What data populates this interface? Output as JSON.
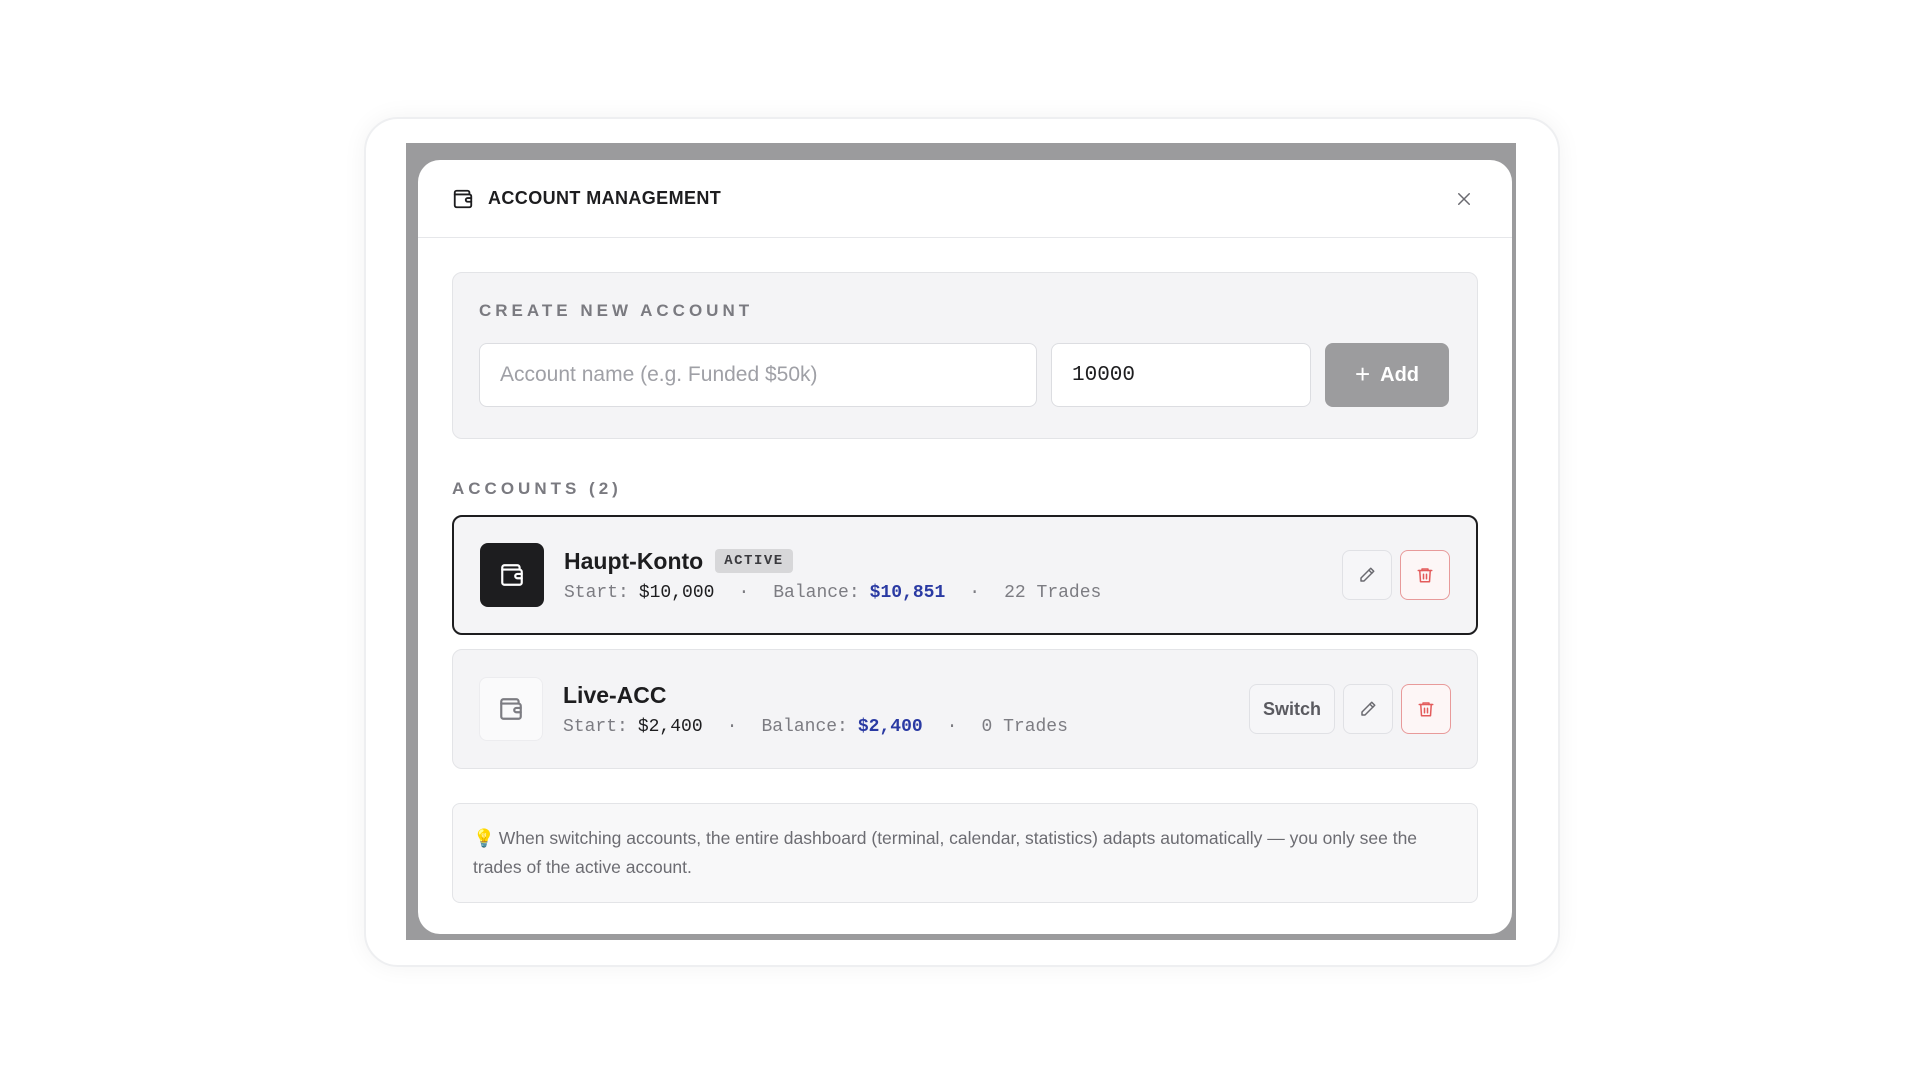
{
  "modal": {
    "title": "ACCOUNT MANAGEMENT",
    "header_icon": "wallet-icon",
    "close_icon": "close-icon"
  },
  "create": {
    "section_label": "CREATE NEW ACCOUNT",
    "name_placeholder": "Account name (e.g. Funded $50k)",
    "name_value": "",
    "amount_value": "10000",
    "add_label": "Add",
    "add_icon": "plus-icon"
  },
  "accounts": {
    "section_label": "ACCOUNTS (2)",
    "items": [
      {
        "name": "Haupt-Konto",
        "badge": "ACTIVE",
        "start_label": "Start:",
        "start_value": "$10,000",
        "balance_label": "Balance:",
        "balance_value": "$10,851",
        "trades": "22 Trades",
        "active": true
      },
      {
        "name": "Live-ACC",
        "start_label": "Start:",
        "start_value": "$2,400",
        "balance_label": "Balance:",
        "balance_value": "$2,400",
        "trades": "0 Trades",
        "switch_label": "Switch",
        "active": false
      }
    ],
    "separator": "·"
  },
  "hint": {
    "icon": "lightbulb-icon",
    "text": "When switching accounts, the entire dashboard (terminal, calendar, statistics) adapts automatically — you only see the trades of the active account."
  },
  "colors": {
    "balance": "#2a3aa3",
    "active_icon_bg": "#1d1d1f",
    "danger": "#e35b5b",
    "backdrop": "#9b9b9d"
  }
}
